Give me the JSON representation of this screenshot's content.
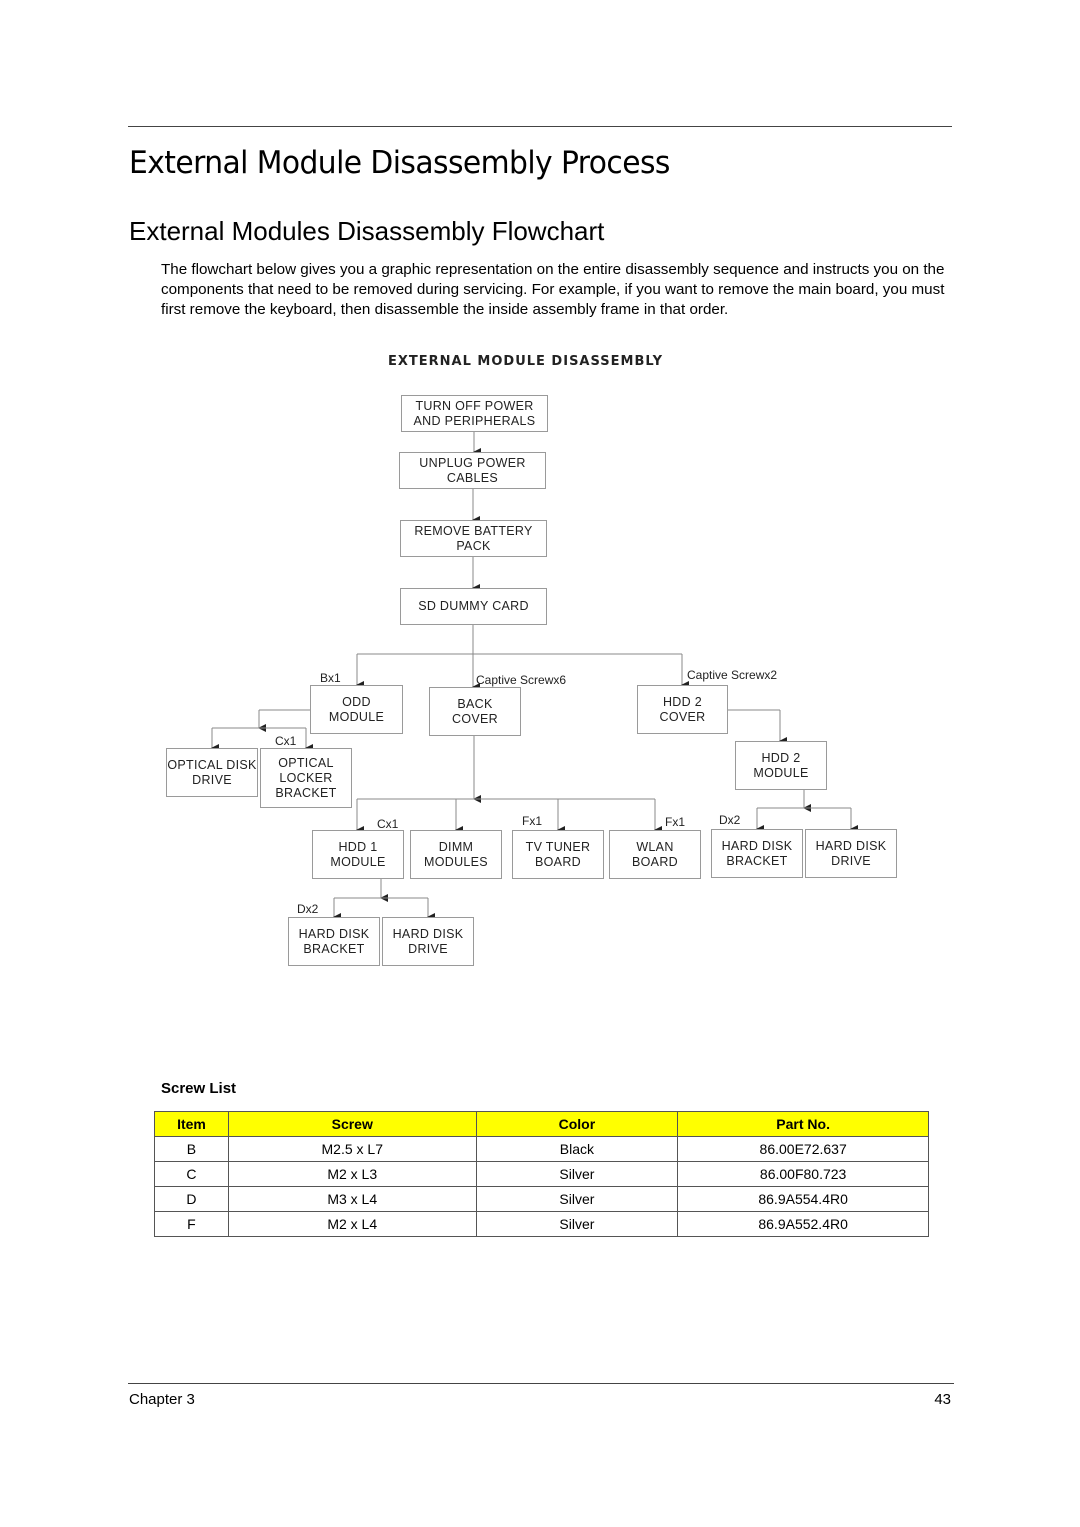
{
  "page": {
    "title": "External Module Disassembly Process",
    "subtitle": "External Modules Disassembly Flowchart",
    "intro": "The flowchart below gives you a graphic representation on the entire disassembly sequence and instructs you on the components that need to be removed during servicing. For example, if you want to remove the main board, you must first remove the keyboard, then disassemble the inside assembly frame in that order."
  },
  "flowchart": {
    "title": "EXTERNAL MODULE DISASSEMBLY",
    "nodes": {
      "turn_off": "TURN OFF POWER\nAND PERIPHERALS",
      "unplug": "UNPLUG POWER\nCABLES",
      "battery": "REMOVE BATTERY\nPACK",
      "sd_dummy": "SD DUMMY CARD",
      "odd_module": "ODD\nMODULE",
      "back_cover": "BACK\nCOVER",
      "hdd2_cover": "HDD 2\nCOVER",
      "optical_disk_drive": "OPTICAL DISK\nDRIVE",
      "optical_locker_bracket": "OPTICAL\nLOCKER\nBRACKET",
      "hdd2_module": "HDD 2\nMODULE",
      "hdd1_module": "HDD 1\nMODULE",
      "dimm_modules": "DIMM\nMODULES",
      "tv_tuner_board": "TV TUNER\nBOARD",
      "wlan_board": "WLAN\nBOARD",
      "hdd2_bracket": "HARD DISK\nBRACKET",
      "hdd2_drive": "HARD DISK\nDRIVE",
      "hdd1_bracket": "HARD DISK\nBRACKET",
      "hdd1_drive": "HARD DISK\nDRIVE"
    },
    "labels": {
      "odd_screw": "Bx1",
      "back_cover_screw": "Captive Screwx6",
      "hdd2_cover_screw": "Captive Screwx2",
      "locker_screw": "Cx1",
      "hdd1_screw": "Cx1",
      "tv_tuner_screw": "Fx1",
      "wlan_screw": "Fx1",
      "hdd2_bracket_screw": "Dx2",
      "hdd1_bracket_screw": "Dx2"
    }
  },
  "screw_list": {
    "title": "Screw List",
    "header_color": "#ffff00",
    "columns": [
      "Item",
      "Screw",
      "Color",
      "Part No."
    ],
    "rows": [
      [
        "B",
        "M2.5 x L7",
        "Black",
        "86.00E72.637"
      ],
      [
        "C",
        "M2 x L3",
        "Silver",
        "86.00F80.723"
      ],
      [
        "D",
        "M3 x L4",
        "Silver",
        "86.9A554.4R0"
      ],
      [
        "F",
        "M2 x L4",
        "Silver",
        "86.9A552.4R0"
      ]
    ]
  },
  "footer": {
    "chapter": "Chapter 3",
    "page_number": "43"
  }
}
